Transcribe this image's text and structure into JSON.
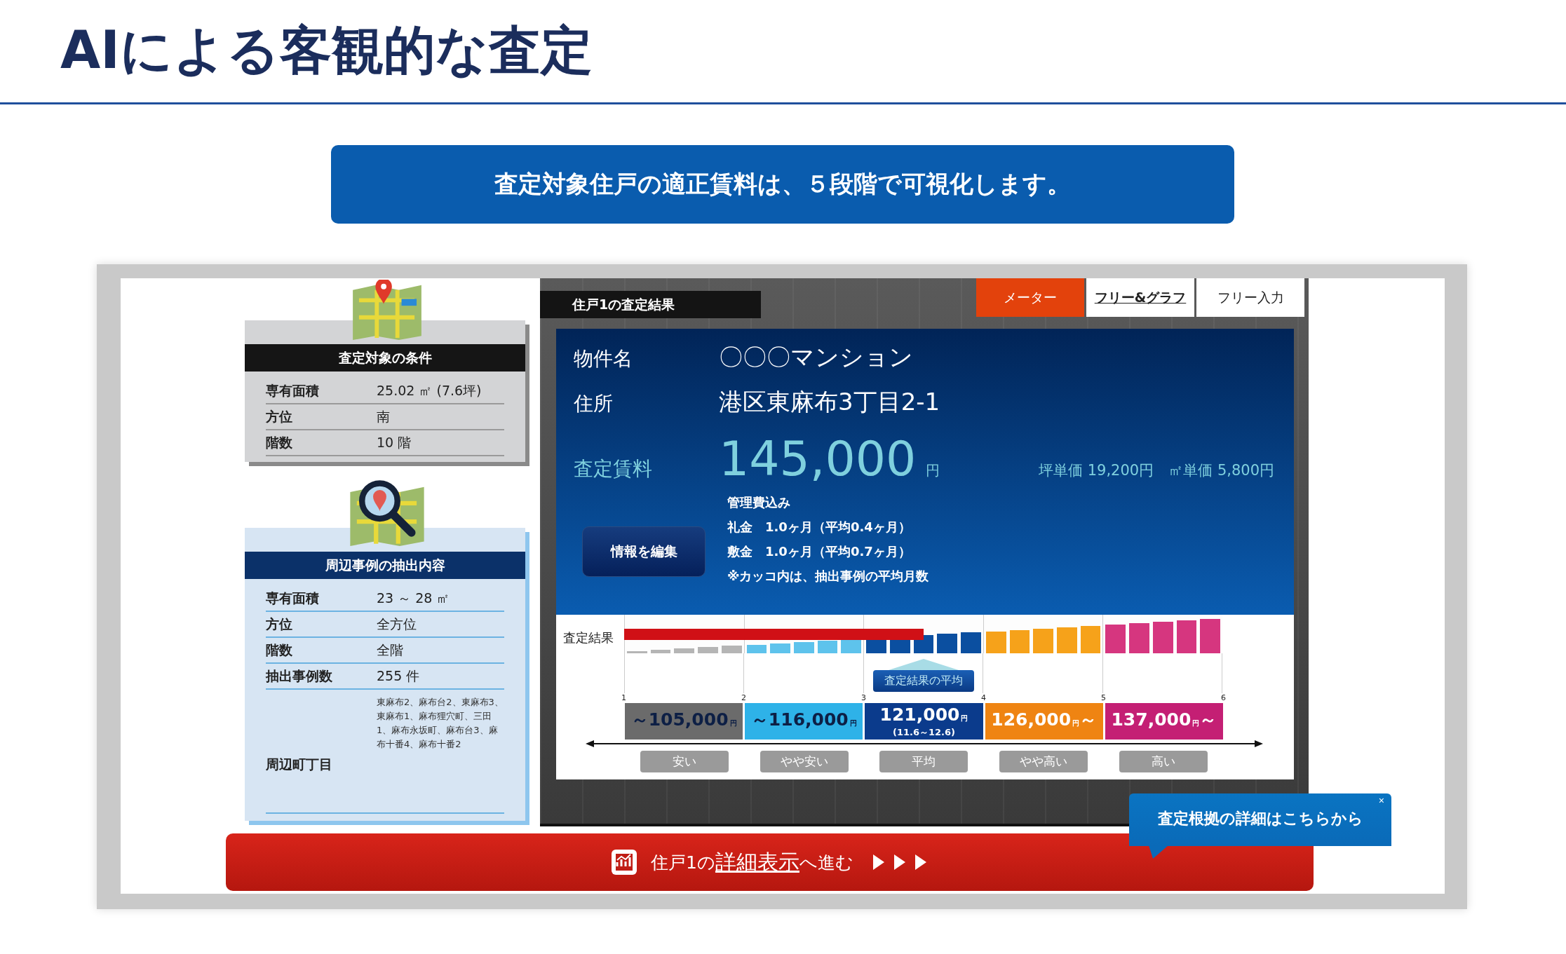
{
  "page_title": "AIによる客観的な査定",
  "banner": "査定対象住戸の適正賃料は、５段階で可視化します。",
  "target_card": {
    "title": "査定対象の条件",
    "rows": [
      {
        "label": "専有面積",
        "value": "25.02 ㎡ (7.6坪)"
      },
      {
        "label": "方位",
        "value": "南"
      },
      {
        "label": "階数",
        "value": "10 階"
      }
    ]
  },
  "nearby_card": {
    "title": "周辺事例の抽出内容",
    "rows": [
      {
        "label": "専有面積",
        "value": "23 ～ 28 ㎡"
      },
      {
        "label": "方位",
        "value": "全方位"
      },
      {
        "label": "階数",
        "value": "全階"
      },
      {
        "label": "抽出事例数",
        "value": "255 件"
      }
    ],
    "area_label": "周辺町丁目",
    "area_value": "東麻布2、麻布台2、東麻布3、東麻布1、麻布狸穴町、三田1、麻布永坂町、麻布台3、麻布十番4、麻布十番2"
  },
  "result": {
    "header": "住戸1の査定結果",
    "tabs": [
      {
        "label": "メーター",
        "selected": true,
        "underlined": false
      },
      {
        "label": "フリー&グラフ",
        "selected": false,
        "underlined": true
      },
      {
        "label": "フリー入力",
        "selected": false,
        "underlined": false
      }
    ],
    "property_label": "物件名",
    "property_value": "〇〇〇マンション",
    "address_label": "住所",
    "address_value": "港区東麻布3丁目2-1",
    "rent_label": "査定賃料",
    "rent_value": "145,000",
    "rent_unit": "円",
    "unit_prices": "坪単価 19,200円　㎡単価 5,800円",
    "notes": [
      "管理費込み",
      "礼金　1.0ヶ月（平均0.4ヶ月）",
      "敷金　1.0ヶ月（平均0.7ヶ月）",
      "※カッコ内は、抽出事例の平均月数"
    ],
    "edit_button": "情報を編集"
  },
  "meter": {
    "label": "査定結果",
    "level": 0.5,
    "average_label": "査定結果の平均",
    "ticks": [
      "1",
      "2",
      "3",
      "4",
      "5",
      "6"
    ],
    "segments": [
      {
        "prefix": "～",
        "amount": "105,000",
        "unit": "円",
        "label": "安い",
        "color": "#6b6b6b",
        "average": false
      },
      {
        "prefix": "～",
        "amount": "116,000",
        "unit": "円",
        "label": "やや安い",
        "color": "#2eb2e8",
        "average": false
      },
      {
        "amount": "121,000",
        "unit": "円",
        "range": "(11.6～12.6)",
        "label": "平均",
        "color": "#0b3b8c",
        "average": true
      },
      {
        "amount": "126,000",
        "unit": "円",
        "suffix": "～",
        "label": "やや高い",
        "color": "#ef8412",
        "average": false
      },
      {
        "amount": "137,000",
        "unit": "円",
        "suffix": "～",
        "label": "高い",
        "color": "#c41f74",
        "average": false
      }
    ]
  },
  "detail_bar": {
    "prefix": "住戸1の",
    "link": "詳細表示",
    "suffix": "へ進む"
  },
  "tooltip": {
    "text": "査定根拠の詳細はこちらから",
    "close": "×"
  }
}
